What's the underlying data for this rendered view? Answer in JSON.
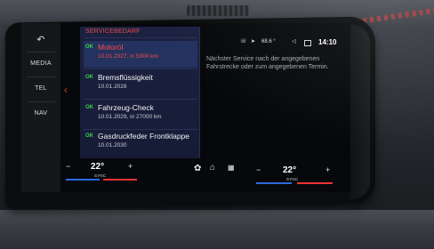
{
  "left_bar": {
    "back_icon": "back-arrow-icon",
    "items": [
      {
        "label": "MEDIA"
      },
      {
        "label": "TEL"
      },
      {
        "label": "NAV"
      }
    ]
  },
  "status_bar": {
    "temperature": "68.6 °",
    "time": "14:10",
    "icons": [
      "phone-icon",
      "location-icon",
      "volume-icon",
      "screen-icon"
    ]
  },
  "panel": {
    "title": "SERVICEBEDARF",
    "items": [
      {
        "status": "OK",
        "title": "Motoröl",
        "detail": "10.01.2027, in 5000 km",
        "selected": true
      },
      {
        "status": "OK",
        "title": "Bremsflüssigkeit",
        "detail": "10.01.2028",
        "selected": false
      },
      {
        "status": "OK",
        "title": "Fahrzeug-Check",
        "detail": "10.01.2029, in 27000 km",
        "selected": false
      },
      {
        "status": "OK",
        "title": "Gasdruckfeder Frontklappe",
        "detail": "10.01.2030",
        "selected": false
      }
    ]
  },
  "info_text": "Nächster Service nach der angegebenen Fahrstrecke oder zum angegebenen Termin.",
  "climate": {
    "left": {
      "minus": "−",
      "temp": "22°",
      "sync": "SYNC",
      "plus": "+"
    },
    "right": {
      "minus": "−",
      "temp": "22°",
      "sync": "SYNC",
      "plus": "+"
    },
    "center_icons": [
      "fan-icon",
      "home-icon",
      "apps-grid-icon"
    ]
  }
}
